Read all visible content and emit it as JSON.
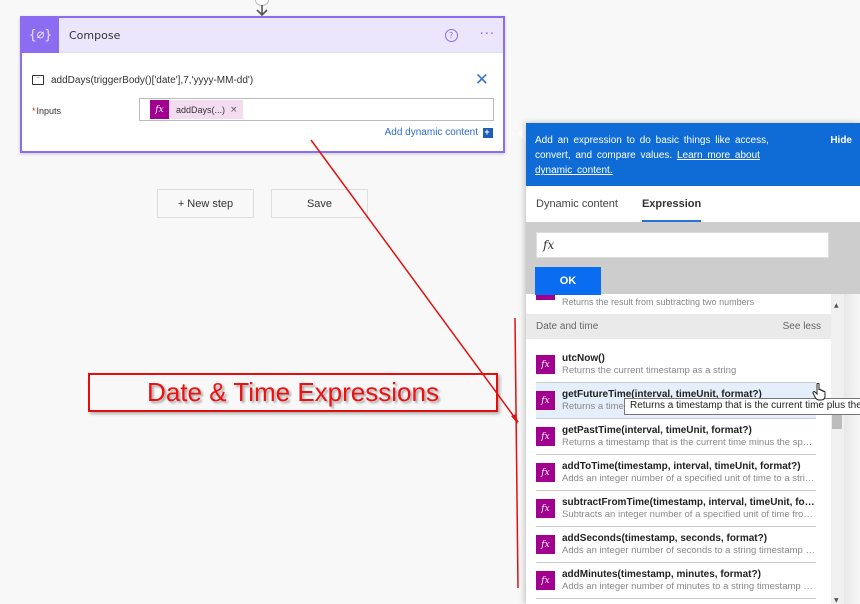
{
  "compose": {
    "title": "Compose",
    "icon": "compose-braces-icon",
    "help_icon": "?",
    "more_icon": "···",
    "expression_text": "addDays(triggerBody()['date'],7,'yyyy-MM-dd')",
    "inputs_required_mark": "*",
    "inputs_label": "Inputs",
    "token_fx": "fx",
    "token_label": "addDays(...)",
    "token_remove": "×",
    "add_dynamic_label": "Add dynamic content",
    "add_dynamic_icon": "+"
  },
  "actions": {
    "new_step_label": "+ New step",
    "save_label": "Save"
  },
  "annotation": {
    "label": "Date & Time Expressions",
    "color": "#ee1111"
  },
  "panel": {
    "info_text": "Add an expression to do basic things like access, convert, and compare values. ",
    "info_link": "Learn more about dynamic content.",
    "hide_label": "Hide",
    "tabs": [
      {
        "label": "Dynamic content",
        "active": false
      },
      {
        "label": "Expression",
        "active": true
      }
    ],
    "fx_placeholder": "fx",
    "ok_label": "OK",
    "partial_row_desc": "Returns the result from subtracting two numbers",
    "section": {
      "title": "Date and time",
      "toggle": "See less"
    },
    "functions": [
      {
        "name": "utcNow()",
        "desc": "Returns the current timestamp as a string"
      },
      {
        "name": "getFutureTime(interval, timeUnit, format?)",
        "desc": "Returns a timestamp that is the current time plus the specified time units."
      },
      {
        "name": "getPastTime(interval, timeUnit, format?)",
        "desc": "Returns a timestamp that is the current time minus the specified time units."
      },
      {
        "name": "addToTime(timestamp, interval, timeUnit, format?)",
        "desc": "Adds an integer number of a specified unit of time to a string timestamp"
      },
      {
        "name": "subtractFromTime(timestamp, interval, timeUnit, format?)",
        "desc": "Subtracts an integer number of a specified unit of time from a string timestamp"
      },
      {
        "name": "addSeconds(timestamp, seconds, format?)",
        "desc": "Adds an integer number of seconds to a string timestamp passed in"
      },
      {
        "name": "addMinutes(timestamp, minutes, format?)",
        "desc": "Adds an integer number of minutes to a string timestamp passed in"
      }
    ],
    "tooltip": "Returns a timestamp that is the current time plus the specified time units."
  },
  "colors": {
    "compose_accent": "#8c6cf0",
    "banner_blue": "#0f6cd6",
    "fx_magenta": "#a1008f",
    "ok_blue": "#0a6cf0"
  }
}
